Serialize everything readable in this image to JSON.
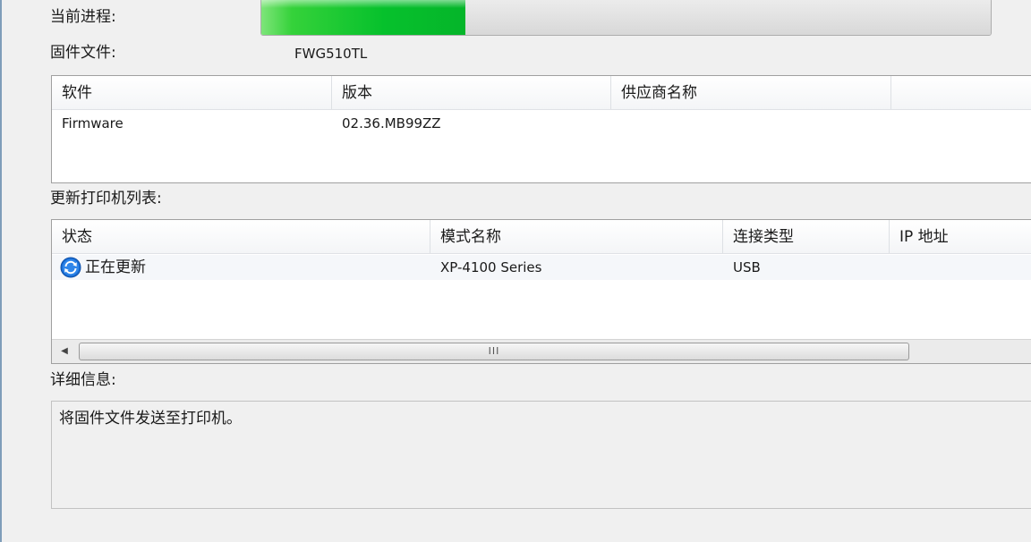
{
  "progress": {
    "label": "当前进程:",
    "percent": 28
  },
  "firmware_file": {
    "label": "固件文件:",
    "value": "FWG510TL"
  },
  "software_table": {
    "columns": [
      "软件",
      "版本",
      "供应商名称",
      ""
    ],
    "rows": [
      {
        "software": "Firmware",
        "version": "02.36.MB99ZZ",
        "vendor": ""
      }
    ]
  },
  "printer_list": {
    "label": "更新打印机列表:",
    "columns": [
      "状态",
      "模式名称",
      "连接类型",
      "IP 地址"
    ],
    "rows": [
      {
        "status": "正在更新",
        "status_icon": "refresh-icon",
        "model": "XP-4100 Series",
        "connection": "USB",
        "ip": ""
      }
    ],
    "scrollbar_grip": "III"
  },
  "details": {
    "label": "详细信息:",
    "text": "将固件文件发送至打印机。"
  },
  "colors": {
    "progress_fill": "#06c12c",
    "icon_blue": "#1a6fd6"
  }
}
